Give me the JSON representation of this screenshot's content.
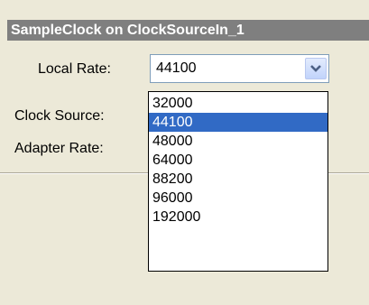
{
  "panel": {
    "title": "SampleClock on ClockSourceIn_1"
  },
  "form": {
    "local_rate_label": "Local Rate:",
    "clock_source_label": "Clock Source:",
    "adapter_rate_label": "Adapter Rate:"
  },
  "local_rate": {
    "value": "44100",
    "options": [
      "32000",
      "44100",
      "48000",
      "64000",
      "88200",
      "96000",
      "192000"
    ],
    "selected_index": 1
  },
  "colors": {
    "title_bar_bg": "#7f7f7f",
    "selection_bg": "#316ac5",
    "window_bg": "#ece9d8"
  },
  "icons": {
    "dropdown_arrow": "chevron-down-icon"
  }
}
